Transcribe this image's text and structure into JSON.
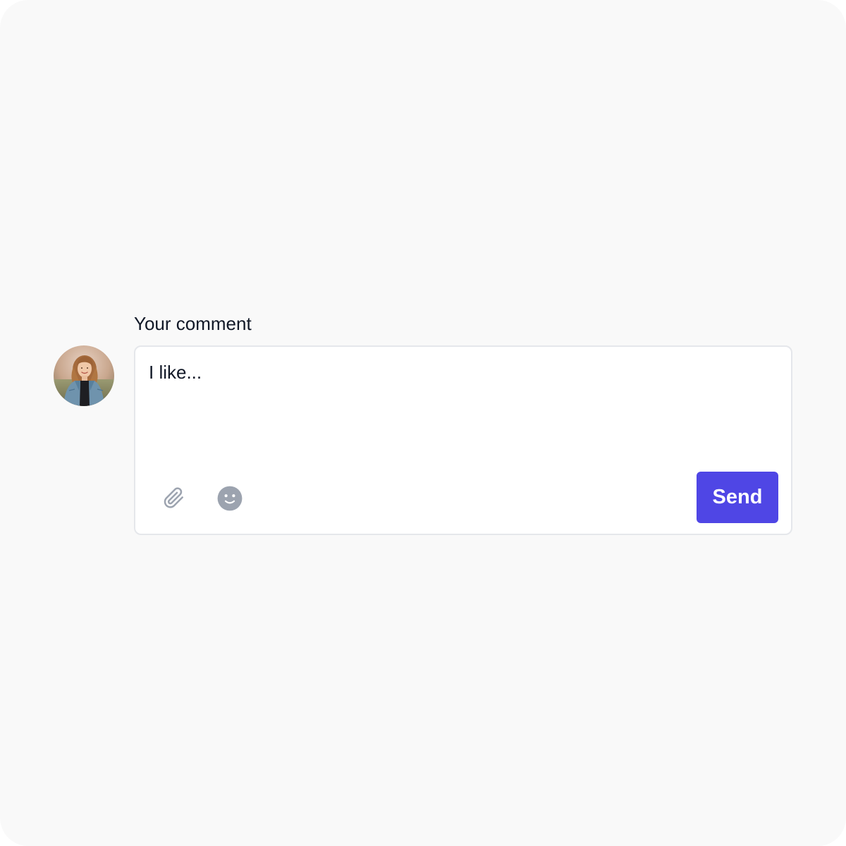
{
  "comment": {
    "label": "Your comment",
    "value": "I like...",
    "send_label": "Send"
  },
  "icons": {
    "attach": "paperclip-icon",
    "emoji": "face-smile-icon"
  },
  "colors": {
    "background": "#f9f9f9",
    "accent": "#4f46e5",
    "icon": "#9ca3af",
    "text": "#111827",
    "border": "#e5e7eb"
  }
}
